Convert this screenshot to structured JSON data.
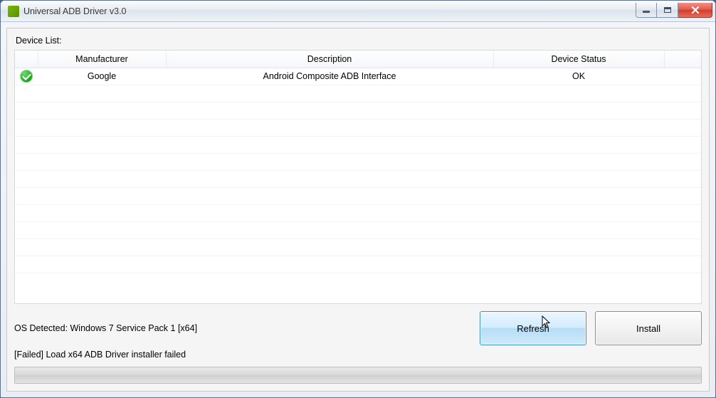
{
  "window": {
    "title": "Universal ADB Driver v3.0"
  },
  "labels": {
    "device_list": "Device List:"
  },
  "grid": {
    "headers": {
      "status": "",
      "manufacturer": "Manufacturer",
      "description": "Description",
      "device_status": "Device Status"
    },
    "rows": [
      {
        "status": "ok",
        "manufacturer": "Google",
        "description": "Android Composite ADB Interface",
        "device_status": "OK"
      }
    ],
    "empty_row_count": 11
  },
  "footer": {
    "os": "OS Detected: Windows 7 Service Pack 1 [x64]",
    "status": "[Failed] Load x64 ADB Driver installer failed",
    "buttons": {
      "refresh": "Refresh",
      "install": "Install"
    },
    "progress_percent": 0
  }
}
